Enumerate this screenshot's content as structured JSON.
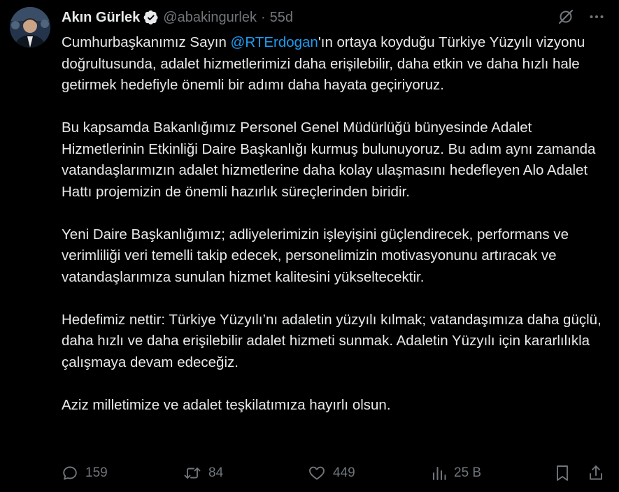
{
  "author": {
    "name": "Akın Gürlek",
    "handle": "@abakingurlek",
    "separator": "·",
    "time": "55d"
  },
  "tweet": {
    "p1_pre": "Cumhurbaşkanımız Sayın ",
    "p1_mention": "@RTErdogan",
    "p1_post": "'ın ortaya koyduğu Türkiye Yüzyılı vizyonu doğrultusunda, adalet hizmetlerimizi daha erişilebilir, daha etkin ve daha hızlı hale getirmek hedefiyle önemli bir adımı daha hayata geçiriyoruz.",
    "p2": "Bu kapsamda Bakanlığımız Personel Genel Müdürlüğü bünyesinde Adalet Hizmetlerinin Etkinliği Daire Başkanlığı kurmuş bulunuyoruz. Bu adım aynı zamanda vatandaşlarımızın adalet hizmetlerine daha kolay ulaşmasını hedefleyen Alo Adalet Hattı projemizin de önemli hazırlık süreçlerinden biridir.",
    "p3": "Yeni Daire Başkanlığımız; adliyelerimizin işleyişini güçlendirecek, performans ve verimliliği veri temelli takip edecek, personelimizin motivasyonunu artıracak ve vatandaşlarımıza sunulan hizmet kalitesini yükseltecektir.",
    "p4": "Hedefimiz nettir: Türkiye Yüzyılı’nı adaletin yüzyılı kılmak; vatandaşımıza daha güçlü, daha hızlı ve daha erişilebilir adalet hizmeti sunmak. Adaletin Yüzyılı için kararlılıkla çalışmaya devam edeceğiz.",
    "p5": "Aziz milletimize ve adalet teşkilatımıza hayırlı olsun."
  },
  "stats": {
    "replies": "159",
    "reposts": "84",
    "likes": "449",
    "views": "25 B"
  },
  "colors": {
    "background": "#000000",
    "text": "#e7e9ea",
    "muted": "#71767b",
    "accent": "#1d9bf0"
  },
  "icons": {
    "verified": "verified-badge-icon",
    "grok": "grok-icon",
    "more": "more-icon",
    "reply": "reply-icon",
    "repost": "repost-icon",
    "like": "heart-icon",
    "views": "views-icon",
    "bookmark": "bookmark-icon",
    "share": "share-icon"
  }
}
